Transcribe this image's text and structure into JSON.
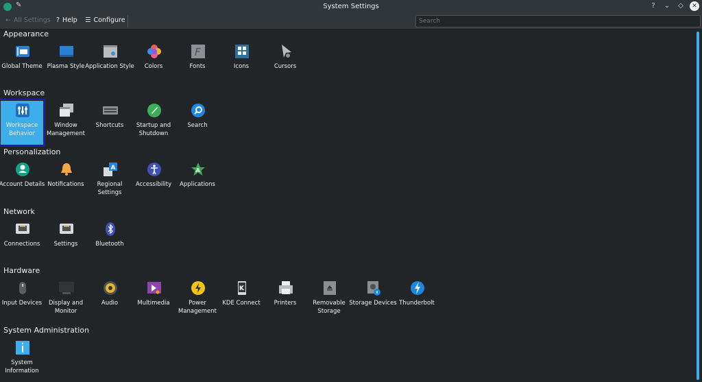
{
  "window": {
    "title": "System Settings",
    "buttons": [
      "help",
      "minimize",
      "maximize",
      "close"
    ]
  },
  "toolbar": {
    "all_settings": "All Settings",
    "help": "Help",
    "configure": "Configure",
    "search_placeholder": "Search"
  },
  "categories": [
    {
      "title": "Appearance",
      "items": [
        {
          "label": "Global Theme",
          "icon": "global-theme-icon"
        },
        {
          "label": "Plasma Style",
          "icon": "plasma-style-icon"
        },
        {
          "label": "Application Style",
          "icon": "application-style-icon"
        },
        {
          "label": "Colors",
          "icon": "colors-icon"
        },
        {
          "label": "Fonts",
          "icon": "fonts-icon"
        },
        {
          "label": "Icons",
          "icon": "icons-icon"
        },
        {
          "label": "Cursors",
          "icon": "cursors-icon"
        }
      ]
    },
    {
      "title": "Workspace",
      "items": [
        {
          "label": "Workspace Behavior",
          "icon": "workspace-behavior-icon",
          "selected": true
        },
        {
          "label": "Window Management",
          "icon": "window-management-icon"
        },
        {
          "label": "Shortcuts",
          "icon": "keyboard-icon"
        },
        {
          "label": "Startup and Shutdown",
          "icon": "rocket-icon"
        },
        {
          "label": "Search",
          "icon": "search-icon"
        }
      ]
    },
    {
      "title": "Personalization",
      "items": [
        {
          "label": "Account Details",
          "icon": "user-icon"
        },
        {
          "label": "Notifications",
          "icon": "bell-icon"
        },
        {
          "label": "Regional Settings",
          "icon": "regional-icon"
        },
        {
          "label": "Accessibility",
          "icon": "accessibility-icon"
        },
        {
          "label": "Applications",
          "icon": "applications-icon"
        }
      ]
    },
    {
      "title": "Network",
      "items": [
        {
          "label": "Connections",
          "icon": "network-port-icon"
        },
        {
          "label": "Settings",
          "icon": "network-port-icon"
        },
        {
          "label": "Bluetooth",
          "icon": "bluetooth-icon"
        }
      ]
    },
    {
      "title": "Hardware",
      "items": [
        {
          "label": "Input Devices",
          "icon": "mouse-icon"
        },
        {
          "label": "Display and Monitor",
          "icon": "monitor-icon"
        },
        {
          "label": "Audio",
          "icon": "speaker-icon"
        },
        {
          "label": "Multimedia",
          "icon": "multimedia-icon"
        },
        {
          "label": "Power Management",
          "icon": "power-icon"
        },
        {
          "label": "KDE Connect",
          "icon": "kde-connect-icon"
        },
        {
          "label": "Printers",
          "icon": "printer-icon"
        },
        {
          "label": "Removable Storage",
          "icon": "eject-icon"
        },
        {
          "label": "Storage Devices",
          "icon": "storage-icon"
        },
        {
          "label": "Thunderbolt",
          "icon": "thunderbolt-icon"
        }
      ]
    },
    {
      "title": "System Administration",
      "items": [
        {
          "label": "System Information",
          "icon": "info-icon"
        }
      ]
    }
  ],
  "colors": {
    "accent": "#3daee9",
    "selection_outline": "#1a1fb0",
    "background": "#232629",
    "toolbar": "#31363b"
  }
}
